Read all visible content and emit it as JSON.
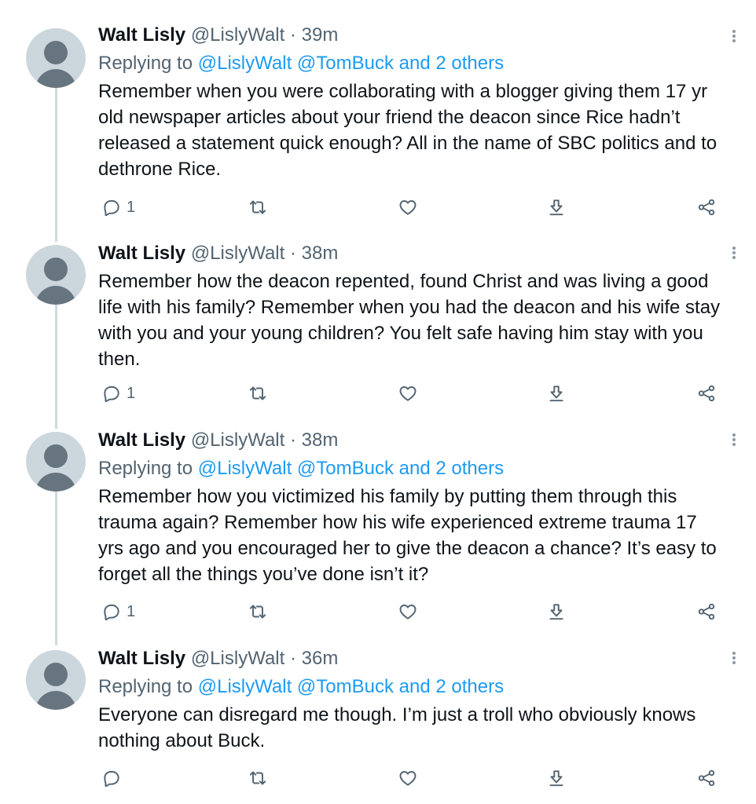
{
  "tweets": [
    {
      "name": "Walt Lisly",
      "handle": "@LislyWalt",
      "separator": "·",
      "time": "39m",
      "replying_prefix": "Replying to",
      "mention1": "@LislyWalt",
      "mention2": "@TomBuck",
      "and_text": "and",
      "others": "2 others",
      "text": "Remember when you were collaborating with a blogger giving them 17 yr old newspaper articles about your friend the deacon since Rice hadn’t released a statement quick enough? All in the name of SBC politics and to dethrone Rice.",
      "reply_count": "1"
    },
    {
      "name": "Walt Lisly",
      "handle": "@LislyWalt",
      "separator": "·",
      "time": "38m",
      "text": "Remember how the deacon repented, found Christ and was living a good life with his family? Remember when you had the deacon and his wife stay with you and your young children? You felt safe having him stay with you then.",
      "reply_count": "1"
    },
    {
      "name": "Walt Lisly",
      "handle": "@LislyWalt",
      "separator": "·",
      "time": "38m",
      "replying_prefix": "Replying to",
      "mention1": "@LislyWalt",
      "mention2": "@TomBuck",
      "and_text": "and",
      "others": "2 others",
      "text": "Remember how you victimized his family by putting them through this trauma again? Remember how his wife experienced extreme trauma 17 yrs ago and you encouraged her to give the deacon a chance? It’s easy to forget all the things you’ve done isn’t it?",
      "reply_count": "1"
    },
    {
      "name": "Walt Lisly",
      "handle": "@LislyWalt",
      "separator": "·",
      "time": "36m",
      "replying_prefix": "Replying to",
      "mention1": "@LislyWalt",
      "mention2": "@TomBuck",
      "and_text": "and",
      "others": "2 others",
      "text": "Everyone can disregard me though. I’m just a troll who obviously knows nothing about Buck.",
      "reply_count": ""
    }
  ],
  "icons": {
    "reply": "reply-icon",
    "retweet": "retweet-icon",
    "like": "heart-icon",
    "download": "download-icon",
    "share": "share-icon",
    "more": "more-options-icon"
  },
  "colors": {
    "mention": "#1d9bf0",
    "secondary_text": "#536471",
    "avatar_bg": "#ccd6dd",
    "avatar_fg": "#66757f",
    "thread_line": "#cfd9de"
  }
}
